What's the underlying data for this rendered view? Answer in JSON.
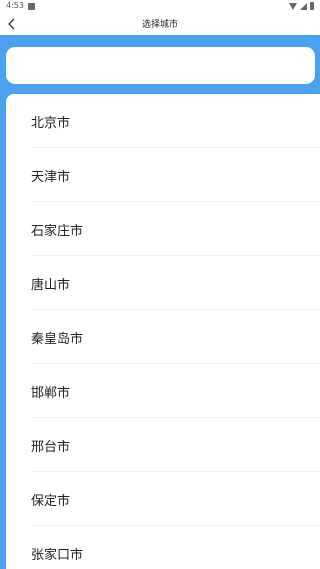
{
  "status_bar": {
    "time": "4:53"
  },
  "header": {
    "title": "选择城市",
    "back_icon": "chevron-left-icon"
  },
  "search": {
    "value": ""
  },
  "cities": [
    {
      "label": "北京市"
    },
    {
      "label": "天津市"
    },
    {
      "label": "石家庄市"
    },
    {
      "label": "唐山市"
    },
    {
      "label": "秦皇岛市"
    },
    {
      "label": "邯郸市"
    },
    {
      "label": "邢台市"
    },
    {
      "label": "保定市"
    },
    {
      "label": "张家口市"
    }
  ],
  "colors": {
    "accent": "#4ba3f0",
    "panel": "#ffffff"
  }
}
